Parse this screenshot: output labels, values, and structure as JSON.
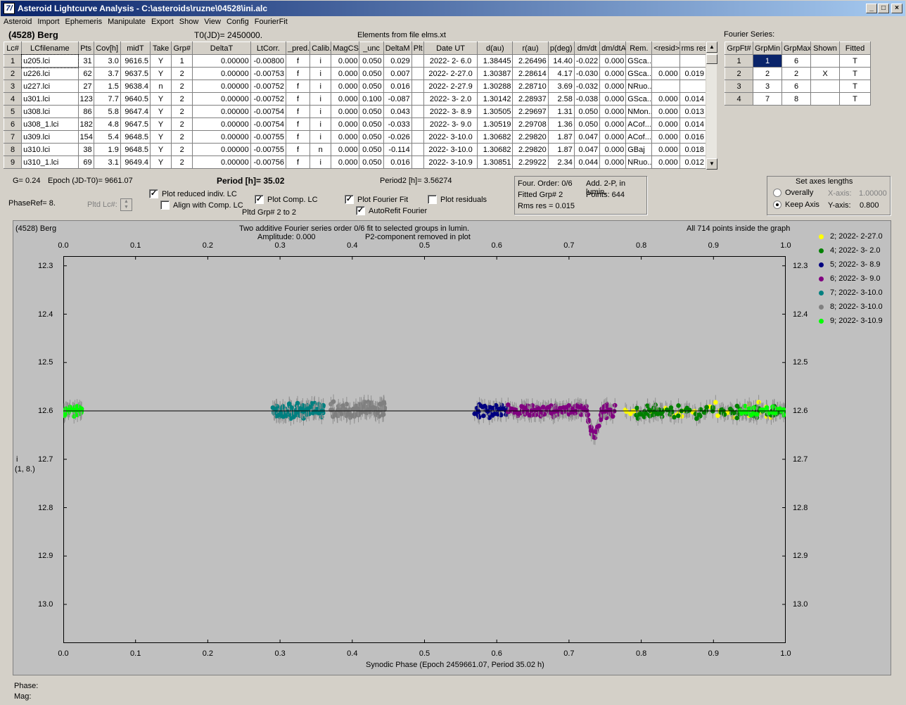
{
  "window": {
    "title": "Asteroid Lightcurve Analysis - C:\\asteroids\\ruzne\\04528\\ini.alc",
    "icon_glyph": "7/"
  },
  "menu": [
    "Asteroid",
    "Import",
    "Ephemeris",
    "Manipulate",
    "Export",
    "Show",
    "View",
    "Config",
    "FourierFit"
  ],
  "header": {
    "asteroid": "(4528) Berg",
    "t0": "T0(JD)= 2450000.",
    "elements": "Elements from file elms.xt"
  },
  "lc_table": {
    "columns": [
      "Lc#",
      "LCfilename",
      "Pts",
      "Cov[h]",
      "midT",
      "Take",
      "Grp#",
      "DeltaT",
      "LtCorr.",
      "_pred.",
      "Calib.",
      "MagCS",
      "_unc",
      "DeltaM",
      "Plt",
      "Date UT",
      "d(au)",
      "r(au)",
      "p(deg)",
      "dm/dt",
      "dm/dtA",
      "Rem.",
      "<resid>",
      "rms res"
    ],
    "rows": [
      [
        "1",
        "u205.lci",
        "31",
        "3.0",
        "9616.5",
        "Y",
        "1",
        "0.00000",
        "-0.00800",
        "f",
        "i",
        "0.000",
        "0.050",
        "0.029",
        "",
        "2022- 2- 6.0",
        "1.38445",
        "2.26496",
        "14.40",
        "-0.022",
        "0.000",
        "GSca...",
        "",
        ""
      ],
      [
        "2",
        "u226.lci",
        "62",
        "3.7",
        "9637.5",
        "Y",
        "2",
        "0.00000",
        "-0.00753",
        "f",
        "i",
        "0.000",
        "0.050",
        "0.007",
        "",
        "2022- 2-27.0",
        "1.30387",
        "2.28614",
        "4.17",
        "-0.030",
        "0.000",
        "GSca...",
        "0.000",
        "0.019"
      ],
      [
        "3",
        "u227.lci",
        "27",
        "1.5",
        "9638.4",
        "n",
        "2",
        "0.00000",
        "-0.00752",
        "f",
        "i",
        "0.000",
        "0.050",
        "0.016",
        "",
        "2022- 2-27.9",
        "1.30288",
        "2.28710",
        "3.69",
        "-0.032",
        "0.000",
        "NRuo...",
        "",
        ""
      ],
      [
        "4",
        "u301.lci",
        "123",
        "7.7",
        "9640.5",
        "Y",
        "2",
        "0.00000",
        "-0.00752",
        "f",
        "i",
        "0.000",
        "0.100",
        "-0.087",
        "",
        "2022- 3- 2.0",
        "1.30142",
        "2.28937",
        "2.58",
        "-0.038",
        "0.000",
        "GSca...",
        "0.000",
        "0.014"
      ],
      [
        "5",
        "u308.lci",
        "86",
        "5.8",
        "9647.4",
        "Y",
        "2",
        "0.00000",
        "-0.00754",
        "f",
        "i",
        "0.000",
        "0.050",
        "0.043",
        "",
        "2022- 3- 8.9",
        "1.30505",
        "2.29697",
        "1.31",
        "0.050",
        "0.000",
        "NMon...",
        "0.000",
        "0.013"
      ],
      [
        "6",
        "u308_1.lci",
        "182",
        "4.8",
        "9647.5",
        "Y",
        "2",
        "0.00000",
        "-0.00754",
        "f",
        "i",
        "0.000",
        "0.050",
        "-0.033",
        "",
        "2022- 3- 9.0",
        "1.30519",
        "2.29708",
        "1.36",
        "0.050",
        "0.000",
        "ACof...",
        "0.000",
        "0.014"
      ],
      [
        "7",
        "u309.lci",
        "154",
        "5.4",
        "9648.5",
        "Y",
        "2",
        "0.00000",
        "-0.00755",
        "f",
        "i",
        "0.000",
        "0.050",
        "-0.026",
        "",
        "2022- 3-10.0",
        "1.30682",
        "2.29820",
        "1.87",
        "0.047",
        "0.000",
        "ACof...",
        "0.000",
        "0.016"
      ],
      [
        "8",
        "u310.lci",
        "38",
        "1.9",
        "9648.5",
        "Y",
        "2",
        "0.00000",
        "-0.00755",
        "f",
        "n",
        "0.000",
        "0.050",
        "-0.114",
        "",
        "2022- 3-10.0",
        "1.30682",
        "2.29820",
        "1.87",
        "0.047",
        "0.000",
        "GBaj",
        "0.000",
        "0.018"
      ],
      [
        "9",
        "u310_1.lci",
        "69",
        "3.1",
        "9649.4",
        "Y",
        "2",
        "0.00000",
        "-0.00756",
        "f",
        "i",
        "0.000",
        "0.050",
        "0.016",
        "",
        "2022- 3-10.9",
        "1.30851",
        "2.29922",
        "2.34",
        "0.044",
        "0.000",
        "NRuo...",
        "0.000",
        "0.012"
      ]
    ]
  },
  "fourier": {
    "label": "Fourier Series:",
    "columns": [
      "GrpFt#",
      "GrpMin",
      "GrpMax",
      "Shown",
      "Fitted"
    ],
    "rows": [
      [
        "1",
        "1",
        "6",
        "",
        "T"
      ],
      [
        "2",
        "2",
        "2",
        "X",
        "T"
      ],
      [
        "3",
        "3",
        "6",
        "",
        "T"
      ],
      [
        "4",
        "7",
        "8",
        "",
        "T"
      ]
    ]
  },
  "controls": {
    "g_text": "G= 0.24",
    "epoch_text": "Epoch (JD-T0)= 9661.07",
    "period_text": "Period [h]= 35.02",
    "period2_text": "Period2 [h]= 3.56274",
    "phaseref": "PhaseRef= 8.",
    "pltd_lc": "Pltd Lc#:",
    "plot_reduced": "Plot reduced indiv. LC",
    "align_comp": "Align with Comp. LC",
    "plot_comp": "Plot Comp. LC",
    "pltd_grp": "Pltd Grp#  2   to   2",
    "plot_fourier": "Plot Fourier Fit",
    "plot_residuals": "Plot residuals",
    "autorefit": "AutoRefit Fourier",
    "info1": "Four. Order:  0/6",
    "info2": "Add. 2-P, in lumin.",
    "info3": "Fitted Grp# 2",
    "info4": "Points: 644",
    "info5": "Rms res      = 0.015",
    "axes_title": "Set axes lengths",
    "overally": "Overally",
    "keep_axis": "Keep Axis",
    "xaxis_label": "X-axis:",
    "xaxis_val": "1.00000",
    "yaxis_label": "Y-axis:",
    "yaxis_val": "0.800"
  },
  "plot": {
    "name": "(4528) Berg",
    "caption1": "Two additive Fourier series order 0/6 fit to selected groups in lumin.",
    "caption2": "Amplitude: 0.000",
    "caption3": "P2-component removed in plot",
    "points_note": "All 714 points inside the graph",
    "xlabel": "Synodic Phase (Epoch 2459661.07, Period 35.02 h)",
    "ylabel1": "i",
    "ylabel2": "(1, 8.)",
    "xticks": [
      "0.0",
      "0.1",
      "0.2",
      "0.3",
      "0.4",
      "0.5",
      "0.6",
      "0.7",
      "0.8",
      "0.9",
      "1.0"
    ],
    "yticks": [
      "12.3",
      "12.4",
      "12.5",
      "12.6",
      "12.7",
      "12.8",
      "12.9",
      "13.0"
    ],
    "legend": [
      {
        "label": "2; 2022- 2-27.0",
        "color": "#ffff00"
      },
      {
        "label": "4; 2022- 3- 2.0",
        "color": "#008000"
      },
      {
        "label": "5; 2022- 3- 8.9",
        "color": "#000080"
      },
      {
        "label": "6; 2022- 3- 9.0",
        "color": "#800080"
      },
      {
        "label": "7; 2022- 3-10.0",
        "color": "#008080"
      },
      {
        "label": "8; 2022- 3-10.0",
        "color": "#808080"
      },
      {
        "label": "9; 2022- 3-10.9",
        "color": "#00ff00"
      }
    ]
  },
  "chart_data": {
    "type": "scatter",
    "title": "Two additive Fourier series order 0/6 fit to selected groups in lumin.",
    "xlabel": "Synodic Phase (Epoch 2459661.07, Period 35.02 h)",
    "ylabel": "i",
    "xlim": [
      0,
      1
    ],
    "ylim": [
      13.08,
      12.28
    ],
    "y_inverted": true,
    "fit_line_y": 12.6,
    "series": [
      {
        "name": "2; 2022- 2-27.0",
        "color": "#ffff00",
        "x_range": [
          0.77,
          1.0
        ],
        "y_center": 12.6,
        "y_spread": 0.02,
        "n": 38,
        "seed": 11
      },
      {
        "name": "4; 2022- 3- 2.0",
        "color": "#008000",
        "x_range": [
          0.79,
          1.0
        ],
        "y_center": 12.602,
        "y_spread": 0.015,
        "n": 110,
        "seed": 22
      },
      {
        "name": "5; 2022- 3- 8.9",
        "color": "#000080",
        "x_range": [
          0.565,
          0.615
        ],
        "y_center": 12.6,
        "y_spread": 0.015,
        "n": 40,
        "seed": 33
      },
      {
        "name": "6; 2022- 3- 9.0",
        "color": "#800080",
        "x_range": [
          0.615,
          0.765
        ],
        "y_center": 12.6,
        "y_spread": 0.015,
        "n": 182,
        "seed": 44
      },
      {
        "name": "7; 2022- 3-10.0",
        "color": "#008080",
        "x_range": [
          0.29,
          0.36
        ],
        "y_center": 12.6,
        "y_spread": 0.018,
        "n": 110,
        "seed": 55
      },
      {
        "name": "8; 2022- 3-10.0",
        "color": "#808080",
        "x_range": [
          0.37,
          0.445
        ],
        "y_center": 12.597,
        "y_spread": 0.018,
        "n": 90,
        "seed": 66
      },
      {
        "name": "9; 2022- 3-10.9",
        "color": "#00ff00",
        "x_range": [
          0.0,
          0.03,
          0.93,
          1.0
        ],
        "y_center": 12.6,
        "y_spread": 0.012,
        "n": 69,
        "seed": 77
      }
    ]
  },
  "status": {
    "phase": "Phase:",
    "mag": "Mag:"
  }
}
